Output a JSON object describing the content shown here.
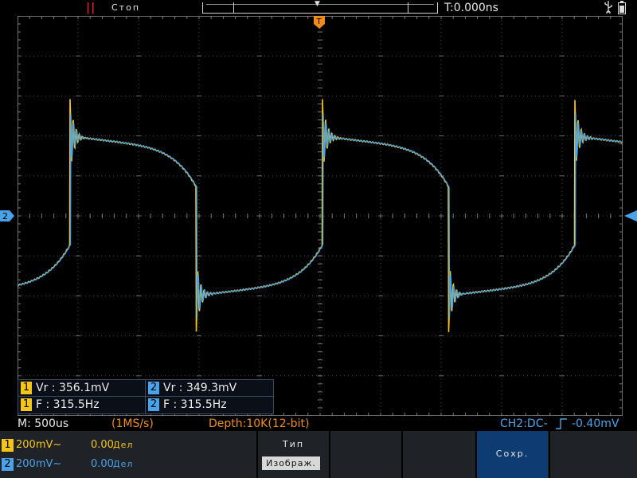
{
  "topbar": {
    "run_state": "Стоп",
    "time_readout": "T:0.000ns"
  },
  "measurements": {
    "ch1_vr_label": "1",
    "ch1_vr": "Vr : 356.1mV",
    "ch2_vr_label": "2",
    "ch2_vr": "Vr : 349.3mV",
    "ch1_f_label": "1",
    "ch1_f": "F : 315.5Hz",
    "ch2_f_label": "2",
    "ch2_f": "F : 315.5Hz"
  },
  "status": {
    "timebase": "M: 500us",
    "sample_rate": "(1MS/s)",
    "depth": "Depth:10K(12-bit)",
    "trigger": "CH2:DC-",
    "trigger_level": "-0.40mV"
  },
  "channels": [
    {
      "number": "1",
      "volts_per_div": "200mV~",
      "offset": "0.00",
      "offset_unit": "Дел",
      "color": "#f5c518"
    },
    {
      "number": "2",
      "volts_per_div": "200mV~",
      "offset": "0.00",
      "offset_unit": "Дел",
      "color": "#4aa3e8"
    }
  ],
  "marker_labels": {
    "ch2_marker": "2",
    "trigger_marker": "T"
  },
  "softkeys": {
    "type_label": "Тип",
    "type_value": "Изображ.",
    "save_label": "Сохр."
  },
  "colors": {
    "ch1": "#f5c518",
    "ch2": "#4aa3e8",
    "trigger": "#f08c1a",
    "run_state": "#e0242a",
    "softkey_active": "#0f3b73"
  }
}
